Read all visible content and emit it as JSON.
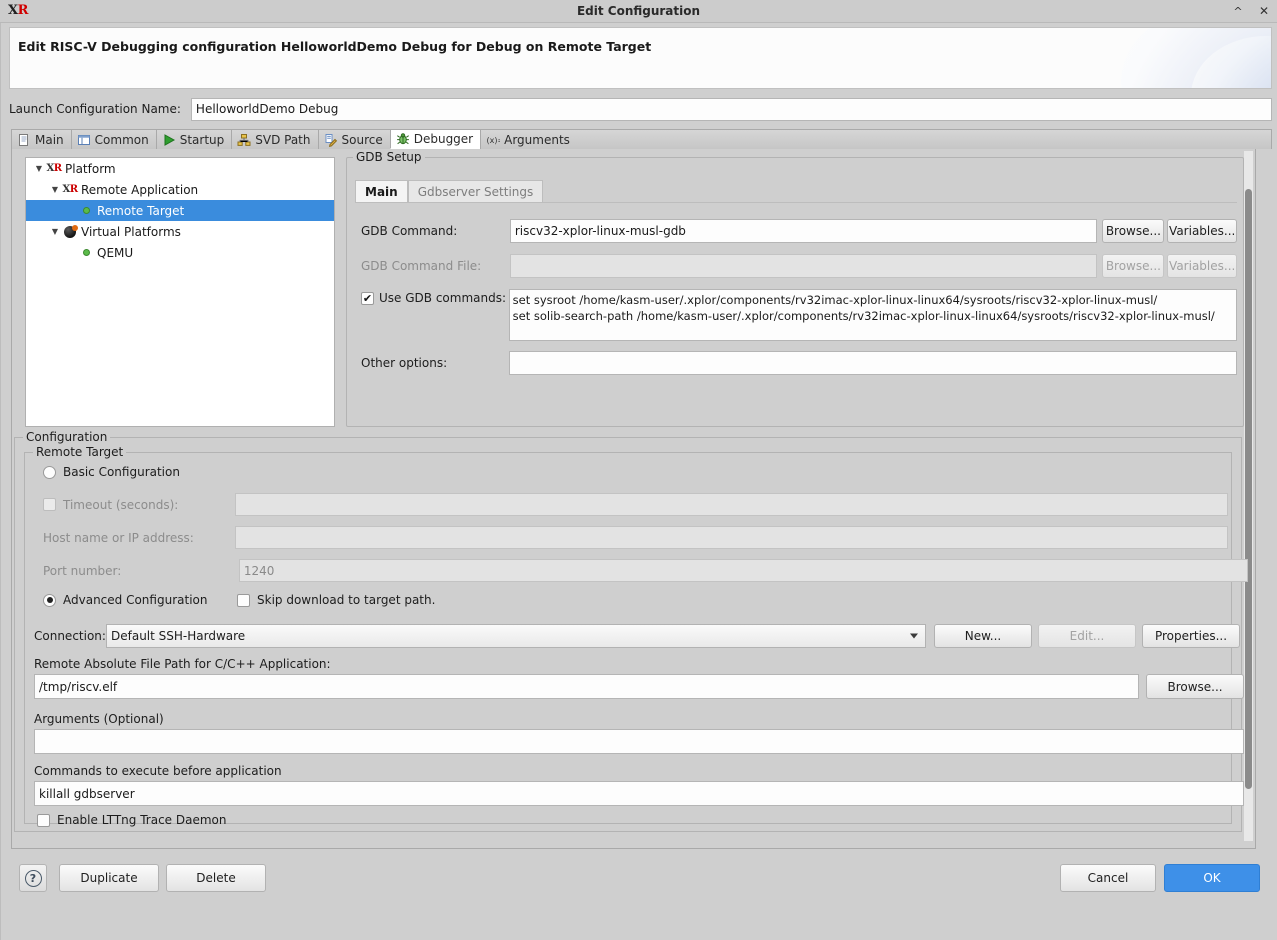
{
  "window": {
    "logo_x": "X",
    "logo_r": "R",
    "title": "Edit Configuration",
    "minimize_label": "^",
    "close_label": "✕"
  },
  "banner": {
    "title": "Edit RISC-V Debugging configuration HelloworldDemo Debug for Debug on Remote Target"
  },
  "launch_config": {
    "label": "Launch Configuration Name:",
    "value": "HelloworldDemo Debug"
  },
  "tabs": [
    {
      "label": "Main",
      "icon": "document-icon",
      "active": false
    },
    {
      "label": "Common",
      "icon": "table-icon",
      "active": false
    },
    {
      "label": "Startup",
      "icon": "play-icon",
      "active": false
    },
    {
      "label": "SVD Path",
      "icon": "network-icon",
      "active": false
    },
    {
      "label": "Source",
      "icon": "source-icon",
      "active": false
    },
    {
      "label": "Debugger",
      "icon": "bug-icon",
      "active": true
    },
    {
      "label": "Arguments",
      "icon": "variable-icon",
      "active": false
    }
  ],
  "tree": [
    {
      "label": "Platform",
      "indent": 0,
      "twisty": "▼",
      "icon": "xr-icon",
      "selected": false
    },
    {
      "label": "Remote Application",
      "indent": 1,
      "twisty": "▼",
      "icon": "xr-icon",
      "selected": false
    },
    {
      "label": "Remote Target",
      "indent": 2,
      "twisty": "",
      "icon": "green-dot-icon",
      "selected": true
    },
    {
      "label": "Virtual Platforms",
      "indent": 1,
      "twisty": "▼",
      "icon": "qemu-icon",
      "selected": false
    },
    {
      "label": "QEMU",
      "indent": 2,
      "twisty": "",
      "icon": "green-dot-icon",
      "selected": false
    }
  ],
  "gdb_setup": {
    "group_title": "GDB Setup",
    "inner_tabs": [
      {
        "label": "Main",
        "active": true,
        "enabled": true
      },
      {
        "label": "Gdbserver Settings",
        "active": false,
        "enabled": false
      }
    ],
    "gdb_command": {
      "label": "GDB Command:",
      "value": "riscv32-xplor-linux-musl-gdb",
      "browse_label": "Browse...",
      "variables_label": "Variables..."
    },
    "gdb_command_file": {
      "label": "GDB Command File:",
      "value": "",
      "browse_label": "Browse...",
      "variables_label": "Variables..."
    },
    "use_gdb_commands": {
      "label": "Use GDB commands:",
      "checked": true,
      "check_glyph": "✔",
      "lines": [
        "set sysroot /home/kasm-user/.xplor/components/rv32imac-xplor-linux-linux64/sysroots/riscv32-xplor-linux-musl/",
        "set solib-search-path /home/kasm-user/.xplor/components/rv32imac-xplor-linux-linux64/sysroots/riscv32-xplor-linux-musl/"
      ]
    },
    "other_options": {
      "label": "Other options:",
      "value": ""
    }
  },
  "configuration": {
    "group_title": "Configuration",
    "remote_target_title": "Remote Target",
    "basic_configuration": {
      "label": "Basic Configuration",
      "selected": false
    },
    "timeout": {
      "label": "Timeout (seconds):",
      "checked": false,
      "value": "",
      "enabled": false
    },
    "host_name": {
      "label": "Host name or IP address:",
      "value": "",
      "enabled": false
    },
    "port_number": {
      "label": "Port number:",
      "value": "1240",
      "enabled": false
    },
    "advanced_configuration": {
      "label": "Advanced Configuration",
      "selected": true
    },
    "skip_download": {
      "label": "Skip download to target path.",
      "checked": false
    },
    "connection": {
      "label": "Connection:",
      "value": "Default SSH-Hardware",
      "new_label": "New...",
      "edit_label": "Edit...",
      "edit_enabled": false,
      "properties_label": "Properties..."
    },
    "remote_path": {
      "label": "Remote Absolute File Path for C/C++ Application:",
      "value": "/tmp/riscv.elf",
      "browse_label": "Browse..."
    },
    "arguments": {
      "label": "Arguments (Optional)",
      "value": ""
    },
    "commands_before": {
      "label": "Commands to execute before application",
      "value": "killall gdbserver"
    },
    "lttng": {
      "label": "Enable LTTng Trace Daemon",
      "checked": false
    }
  },
  "footer": {
    "help_label": "?",
    "duplicate_label": "Duplicate",
    "delete_label": "Delete",
    "cancel_label": "Cancel",
    "ok_label": "OK"
  },
  "colors": {
    "selection_blue": "#3a8cdd",
    "primary_button": "#3e90e8",
    "dialog_bg": "#cfcfcf",
    "field_bg": "#fdfdfd",
    "accent_red": "#cc0000"
  }
}
